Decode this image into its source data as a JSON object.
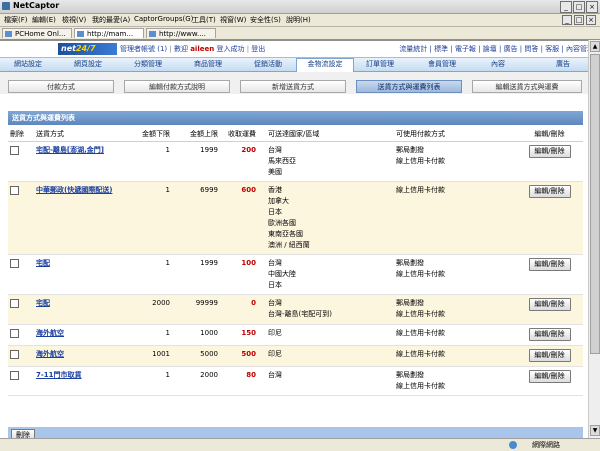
{
  "browser": {
    "title": "NetCaptor",
    "menu": [
      "檔案(F)",
      "編輯(E)",
      "檢視(V)",
      "我的最愛(A)",
      "CaptorGroups(G)",
      "工具(T)",
      "視窗(W)",
      "安全性(S)",
      "說明(H)"
    ],
    "tabs": [
      "PCHome Onl...",
      "http://mam...",
      "http://www...."
    ],
    "status_zone": "網際網路"
  },
  "header": {
    "logo_main": "net",
    "logo_accent": "24/7",
    "admin_text": "管理者帳號 (1)",
    "welcome_user": "aileen",
    "welcome_text": "數迎",
    "welcome_suffix": "登入成功",
    "logout": "登出",
    "right_links": [
      "流量統計",
      "標準",
      "電子報",
      "論壇",
      "廣告",
      "問答",
      "客服",
      "內容管理"
    ]
  },
  "mainnav": [
    "網站設定",
    "網頁設定",
    "分類管理",
    "商品管理",
    "促銷活動",
    "金物流設定",
    "訂單管理",
    "會員管理",
    "內容",
    "廣告"
  ],
  "subtabs": [
    "付款方式",
    "編輯付款方式說明",
    "新增送貨方式",
    "送貨方式與運費列表",
    "編輯送貨方式與運費"
  ],
  "panel_title": "送貨方式與運費列表",
  "table": {
    "headers": [
      "刪除",
      "送貨方式",
      "金額下限",
      "金額上限",
      "收取運費",
      "可送達國家/區域",
      "可使用付款方式",
      "編輯/刪除"
    ],
    "rows": [
      {
        "method": "宅配-離島[澎湖,金門]",
        "min": "1",
        "max": "1999",
        "fee": "200",
        "regions": "台灣\n馬來西亞\n美國",
        "payments": "郵局劃撥\n線上信用卡付款"
      },
      {
        "method": "中華郵政(快遞國際配送)",
        "min": "1",
        "max": "6999",
        "fee": "600",
        "regions": "香港\n加拿大\n日本\n歐洲各國\n東南亞各國\n澳洲 / 紐西蘭",
        "payments": "線上信用卡付款"
      },
      {
        "method": "宅配",
        "min": "1",
        "max": "1999",
        "fee": "100",
        "regions": "台灣\n中國大陸\n日本",
        "payments": "郵局劃撥\n線上信用卡付款"
      },
      {
        "method": "宅配",
        "min": "2000",
        "max": "99999",
        "fee": "0",
        "regions": "台灣\n台灣-離島(宅配可到)",
        "payments": "郵局劃撥\n線上信用卡付款"
      },
      {
        "method": "海外航空",
        "min": "1",
        "max": "1000",
        "fee": "150",
        "regions": "印尼",
        "payments": "線上信用卡付款"
      },
      {
        "method": "海外航空",
        "min": "1001",
        "max": "5000",
        "fee": "500",
        "regions": "印尼",
        "payments": "線上信用卡付款"
      },
      {
        "method": "7-11門市取貨",
        "min": "1",
        "max": "2000",
        "fee": "80",
        "regions": "台灣",
        "payments": "郵局劃撥\n線上信用卡付款"
      }
    ],
    "edit_label": "編輯/刪除"
  },
  "delete_button": "刪除"
}
